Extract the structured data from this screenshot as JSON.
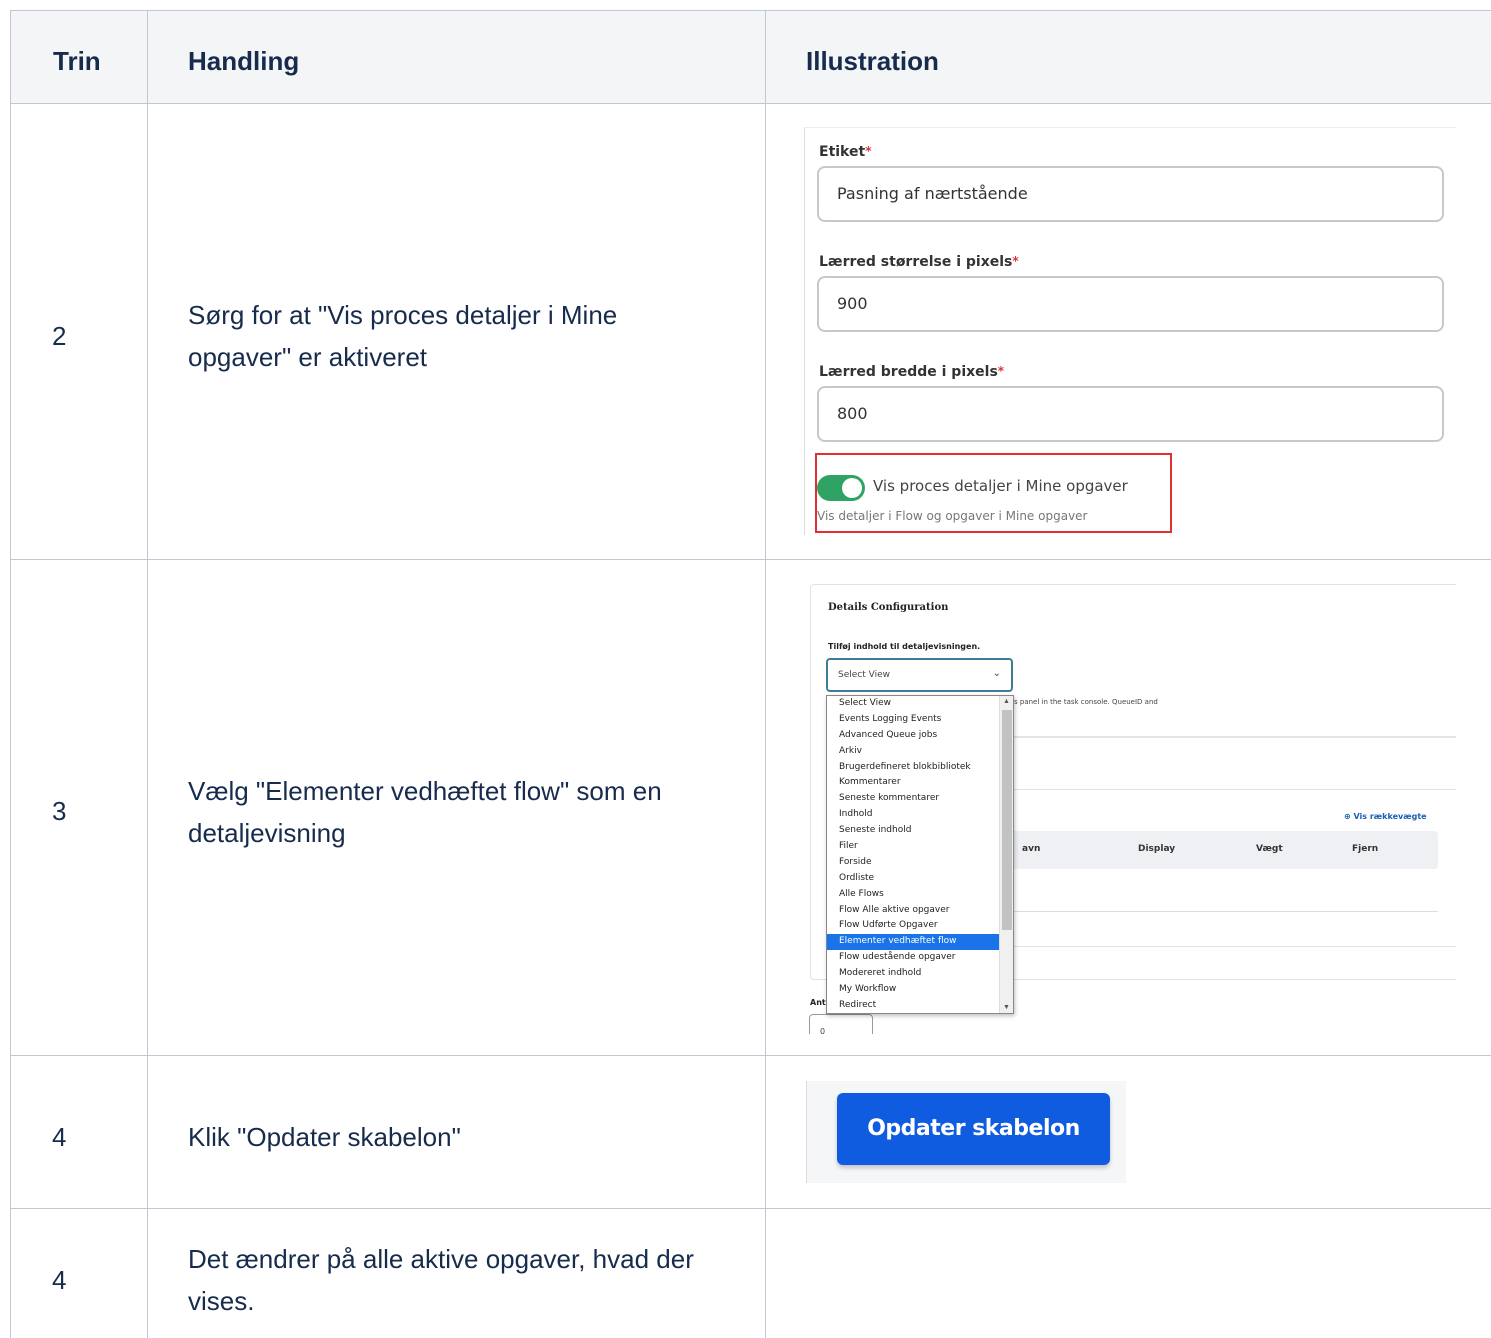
{
  "headers": {
    "trin": "Trin",
    "handling": "Handling",
    "illustration": "Illustration"
  },
  "rows": [
    {
      "trin": "2",
      "handling": "Sørg for at \"Vis proces detaljer i Mine opgaver\" er aktiveret"
    },
    {
      "trin": "3",
      "handling": "Vælg \"Elementer vedhæftet flow\" som en detaljevisning"
    },
    {
      "trin": "4",
      "handling": "Klik \"Opdater skabelon\""
    },
    {
      "trin": "4",
      "handling": "Det ændrer på alle aktive opgaver, hvad der vises."
    }
  ],
  "ill2": {
    "etiket_label": "Etiket",
    "etiket_value": "Pasning af nærtstående",
    "height_label": "Lærred størrelse i pixels",
    "height_value": "900",
    "width_label": "Lærred bredde i pixels",
    "width_value": "800",
    "toggle_label": "Vis proces detaljer i Mine opgaver",
    "toggle_help": "Vis detaljer i Flow og opgaver i Mine opgaver",
    "toggle_on": true
  },
  "ill3": {
    "title": "Details Configuration",
    "subtitle": "Tilføj indhold til detaljevisningen.",
    "select_value": "Select View",
    "hint": "s panel in the task console. QueueID and",
    "vis_link": "⊕ Vis rækkevægte",
    "col_navn": "avn",
    "col_display": "Display",
    "col_vaegt": "Vægt",
    "col_fjern": "Fjern",
    "ant_label": "Ant",
    "ant_value": "0",
    "options": [
      "Select View",
      "Events Logging Events",
      "Advanced Queue jobs",
      "Arkiv",
      "Brugerdefineret blokbibliotek",
      "Kommentarer",
      "Seneste kommentarer",
      "Indhold",
      "Seneste indhold",
      "Filer",
      "Forside",
      "Ordliste",
      "Alle Flows",
      "Flow Alle aktive opgaver",
      "Flow Udførte Opgaver",
      "Elementer vedhæftet flow",
      "Flow udestående opgaver",
      "Modereret indhold",
      "My Workflow",
      "Redirect"
    ],
    "highlighted_option": "Elementer vedhæftet flow"
  },
  "ill4": {
    "button_label": "Opdater skabelon",
    "button_color": "#0f5ce0"
  }
}
